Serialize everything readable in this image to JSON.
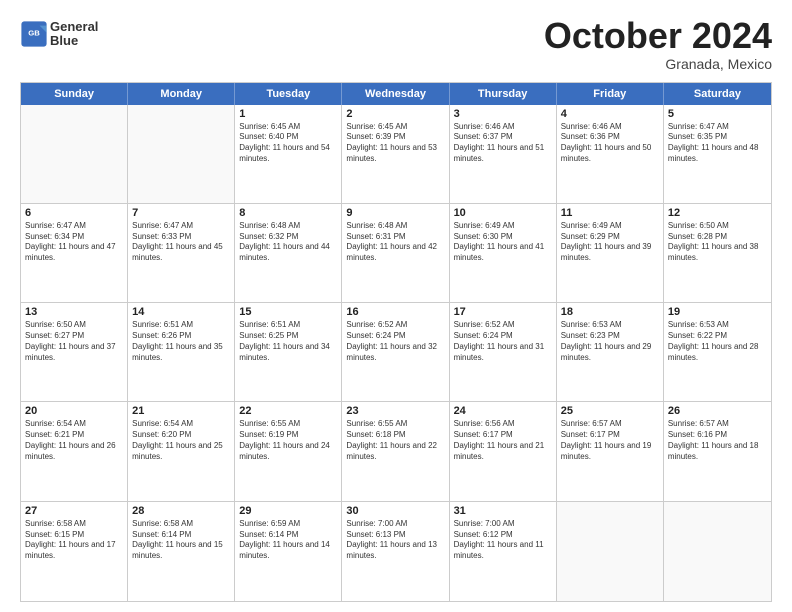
{
  "header": {
    "logo": {
      "line1": "General",
      "line2": "Blue"
    },
    "title": "October 2024",
    "subtitle": "Granada, Mexico"
  },
  "weekdays": [
    "Sunday",
    "Monday",
    "Tuesday",
    "Wednesday",
    "Thursday",
    "Friday",
    "Saturday"
  ],
  "rows": [
    [
      {
        "day": "",
        "empty": true
      },
      {
        "day": "",
        "empty": true
      },
      {
        "day": "1",
        "sunrise": "6:45 AM",
        "sunset": "6:40 PM",
        "daylight": "Daylight: 11 hours and 54 minutes."
      },
      {
        "day": "2",
        "sunrise": "6:45 AM",
        "sunset": "6:39 PM",
        "daylight": "Daylight: 11 hours and 53 minutes."
      },
      {
        "day": "3",
        "sunrise": "6:46 AM",
        "sunset": "6:37 PM",
        "daylight": "Daylight: 11 hours and 51 minutes."
      },
      {
        "day": "4",
        "sunrise": "6:46 AM",
        "sunset": "6:36 PM",
        "daylight": "Daylight: 11 hours and 50 minutes."
      },
      {
        "day": "5",
        "sunrise": "6:47 AM",
        "sunset": "6:35 PM",
        "daylight": "Daylight: 11 hours and 48 minutes."
      }
    ],
    [
      {
        "day": "6",
        "sunrise": "6:47 AM",
        "sunset": "6:34 PM",
        "daylight": "Daylight: 11 hours and 47 minutes."
      },
      {
        "day": "7",
        "sunrise": "6:47 AM",
        "sunset": "6:33 PM",
        "daylight": "Daylight: 11 hours and 45 minutes."
      },
      {
        "day": "8",
        "sunrise": "6:48 AM",
        "sunset": "6:32 PM",
        "daylight": "Daylight: 11 hours and 44 minutes."
      },
      {
        "day": "9",
        "sunrise": "6:48 AM",
        "sunset": "6:31 PM",
        "daylight": "Daylight: 11 hours and 42 minutes."
      },
      {
        "day": "10",
        "sunrise": "6:49 AM",
        "sunset": "6:30 PM",
        "daylight": "Daylight: 11 hours and 41 minutes."
      },
      {
        "day": "11",
        "sunrise": "6:49 AM",
        "sunset": "6:29 PM",
        "daylight": "Daylight: 11 hours and 39 minutes."
      },
      {
        "day": "12",
        "sunrise": "6:50 AM",
        "sunset": "6:28 PM",
        "daylight": "Daylight: 11 hours and 38 minutes."
      }
    ],
    [
      {
        "day": "13",
        "sunrise": "6:50 AM",
        "sunset": "6:27 PM",
        "daylight": "Daylight: 11 hours and 37 minutes."
      },
      {
        "day": "14",
        "sunrise": "6:51 AM",
        "sunset": "6:26 PM",
        "daylight": "Daylight: 11 hours and 35 minutes."
      },
      {
        "day": "15",
        "sunrise": "6:51 AM",
        "sunset": "6:25 PM",
        "daylight": "Daylight: 11 hours and 34 minutes."
      },
      {
        "day": "16",
        "sunrise": "6:52 AM",
        "sunset": "6:24 PM",
        "daylight": "Daylight: 11 hours and 32 minutes."
      },
      {
        "day": "17",
        "sunrise": "6:52 AM",
        "sunset": "6:24 PM",
        "daylight": "Daylight: 11 hours and 31 minutes."
      },
      {
        "day": "18",
        "sunrise": "6:53 AM",
        "sunset": "6:23 PM",
        "daylight": "Daylight: 11 hours and 29 minutes."
      },
      {
        "day": "19",
        "sunrise": "6:53 AM",
        "sunset": "6:22 PM",
        "daylight": "Daylight: 11 hours and 28 minutes."
      }
    ],
    [
      {
        "day": "20",
        "sunrise": "6:54 AM",
        "sunset": "6:21 PM",
        "daylight": "Daylight: 11 hours and 26 minutes."
      },
      {
        "day": "21",
        "sunrise": "6:54 AM",
        "sunset": "6:20 PM",
        "daylight": "Daylight: 11 hours and 25 minutes."
      },
      {
        "day": "22",
        "sunrise": "6:55 AM",
        "sunset": "6:19 PM",
        "daylight": "Daylight: 11 hours and 24 minutes."
      },
      {
        "day": "23",
        "sunrise": "6:55 AM",
        "sunset": "6:18 PM",
        "daylight": "Daylight: 11 hours and 22 minutes."
      },
      {
        "day": "24",
        "sunrise": "6:56 AM",
        "sunset": "6:17 PM",
        "daylight": "Daylight: 11 hours and 21 minutes."
      },
      {
        "day": "25",
        "sunrise": "6:57 AM",
        "sunset": "6:17 PM",
        "daylight": "Daylight: 11 hours and 19 minutes."
      },
      {
        "day": "26",
        "sunrise": "6:57 AM",
        "sunset": "6:16 PM",
        "daylight": "Daylight: 11 hours and 18 minutes."
      }
    ],
    [
      {
        "day": "27",
        "sunrise": "6:58 AM",
        "sunset": "6:15 PM",
        "daylight": "Daylight: 11 hours and 17 minutes."
      },
      {
        "day": "28",
        "sunrise": "6:58 AM",
        "sunset": "6:14 PM",
        "daylight": "Daylight: 11 hours and 15 minutes."
      },
      {
        "day": "29",
        "sunrise": "6:59 AM",
        "sunset": "6:14 PM",
        "daylight": "Daylight: 11 hours and 14 minutes."
      },
      {
        "day": "30",
        "sunrise": "7:00 AM",
        "sunset": "6:13 PM",
        "daylight": "Daylight: 11 hours and 13 minutes."
      },
      {
        "day": "31",
        "sunrise": "7:00 AM",
        "sunset": "6:12 PM",
        "daylight": "Daylight: 11 hours and 11 minutes."
      },
      {
        "day": "",
        "empty": true
      },
      {
        "day": "",
        "empty": true
      }
    ]
  ]
}
